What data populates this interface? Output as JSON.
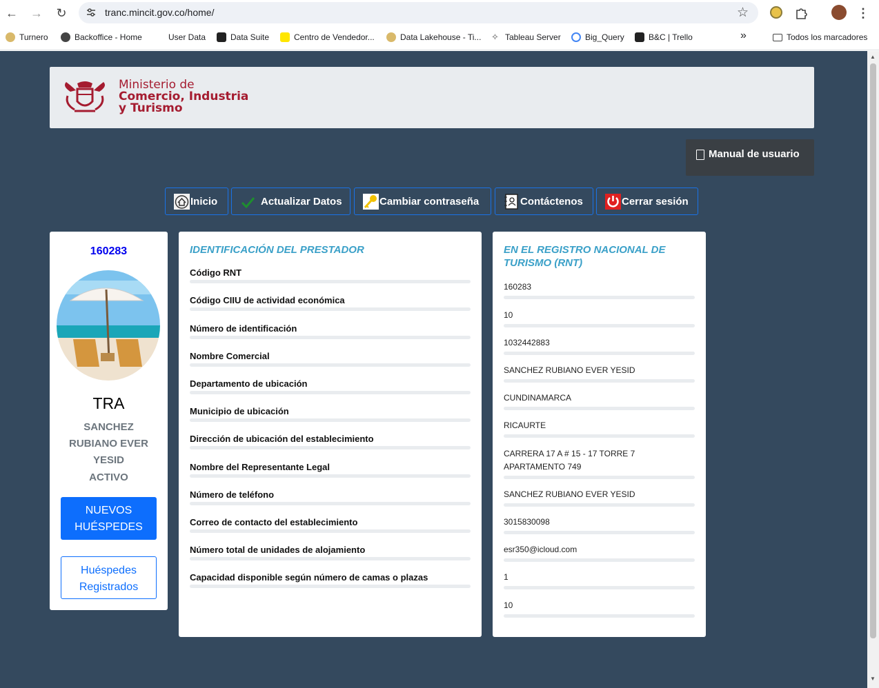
{
  "browser": {
    "url": "tranc.mincit.gov.co/home/",
    "bookmarks": [
      "Turnero",
      "Backoffice - Home",
      "User Data",
      "Data Suite",
      "Centro de Vendedor...",
      "Data Lakehouse - Ti...",
      "Tableau Server",
      "Big_Query",
      "B&C | Trello"
    ],
    "overflow": "»",
    "all_bookmarks": "Todos los marcadores"
  },
  "header": {
    "logo_line1": "Ministerio de",
    "logo_line2": "Comercio, Industria",
    "logo_line3": "y Turismo"
  },
  "manual_label": "Manual de usuario",
  "menu": [
    {
      "label": "Inicio"
    },
    {
      "label": "Actualizar Datos"
    },
    {
      "label": "Cambiar contraseña"
    },
    {
      "label": "Contáctenos"
    },
    {
      "label": "Cerrar sesión"
    }
  ],
  "profile": {
    "code": "160283",
    "type": "TRA",
    "name": "SANCHEZ RUBIANO EVER YESID",
    "status": "ACTIVO",
    "new_guests": "NUEVOS HUÉSPEDES",
    "registered_guests": "Huéspedes Registrados"
  },
  "fields_title": "IDENTIFICACIÓN DEL PRESTADOR",
  "values_title": "EN EL REGISTRO NACIONAL DE TURISMO (RNT)",
  "fields": [
    {
      "label": "Código RNT",
      "value": "160283"
    },
    {
      "label": "Código CIIU de actividad económica",
      "value": "10"
    },
    {
      "label": "Número de identificación",
      "value": "1032442883"
    },
    {
      "label": "Nombre Comercial",
      "value": "SANCHEZ RUBIANO EVER YESID"
    },
    {
      "label": "Departamento de ubicación",
      "value": "CUNDINAMARCA"
    },
    {
      "label": "Municipio de ubicación",
      "value": "RICAURTE"
    },
    {
      "label": "Dirección de ubicación del establecimiento",
      "value": "CARRERA 17 A # 15 - 17 TORRE 7 APARTAMENTO 749"
    },
    {
      "label": "Nombre del Representante Legal",
      "value": "SANCHEZ RUBIANO EVER YESID"
    },
    {
      "label": "Número de teléfono",
      "value": "3015830098"
    },
    {
      "label": "Correo de contacto del establecimiento",
      "value": "esr350@icloud.com"
    },
    {
      "label": "Número total de unidades de alojamiento",
      "value": "1"
    },
    {
      "label": "Capacidad disponible según número de camas o plazas",
      "value": "10"
    }
  ]
}
